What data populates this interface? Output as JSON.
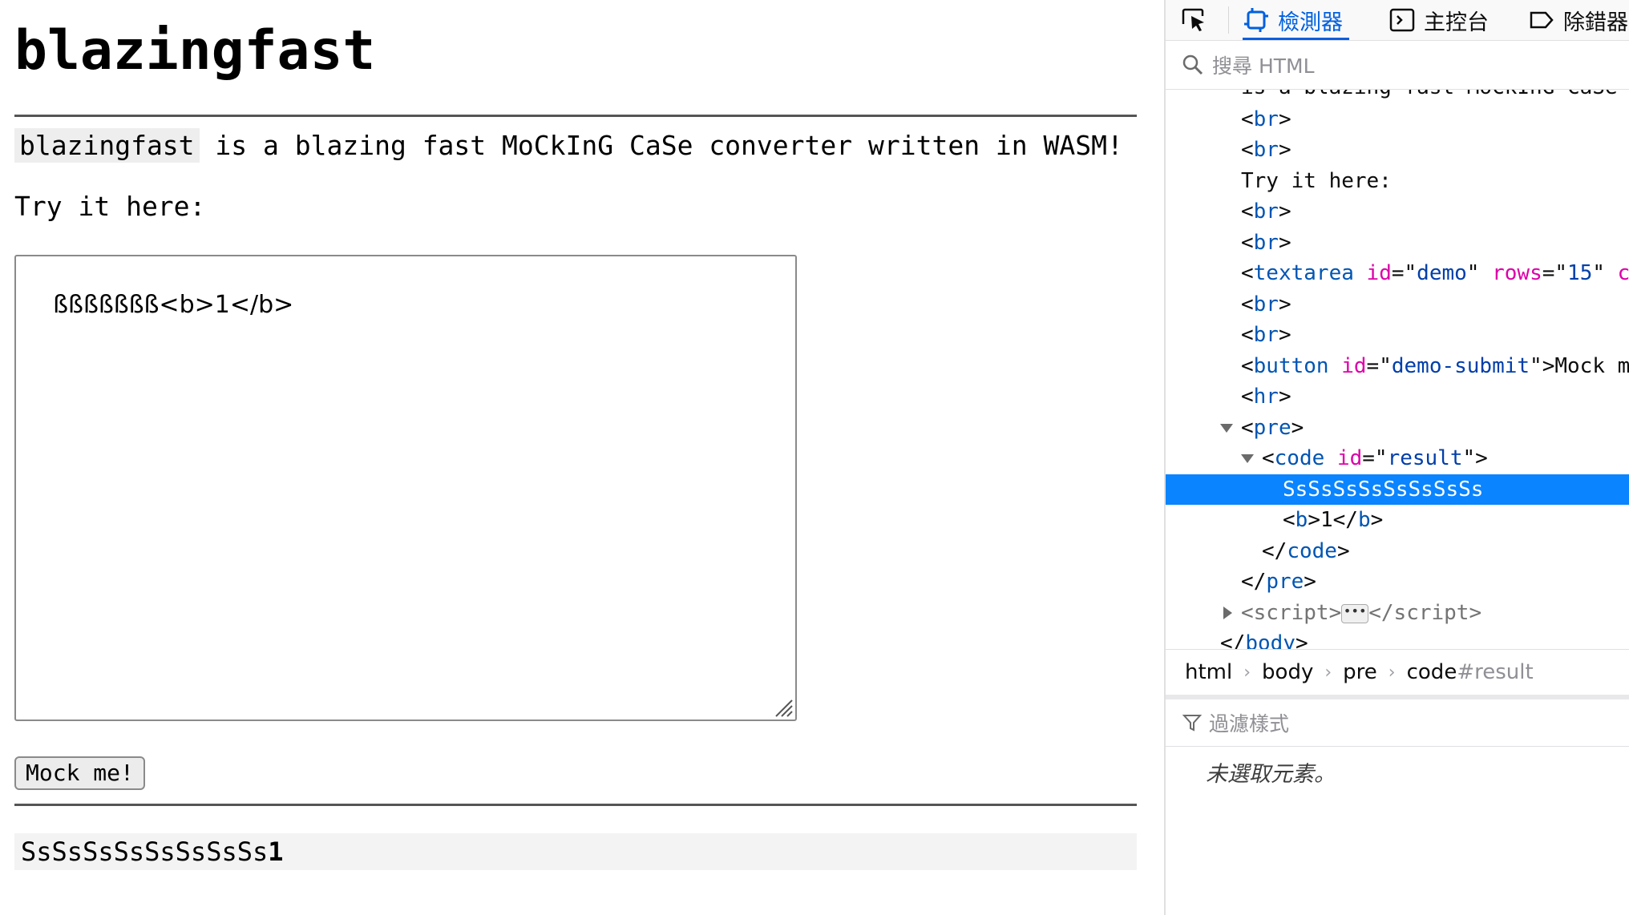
{
  "page": {
    "title": "blazingfast",
    "intro_code": "blazingfast",
    "intro_rest": " is a blazing fast MoCkInG CaSe converter written in WASM!",
    "try_label": "Try it here:",
    "textarea_value": "ßßßßßßß<b>1</b>",
    "button_label": "Mock me!",
    "result_text": "SsSsSsSsSsSsSsSs",
    "result_bold": "1"
  },
  "devtools": {
    "tabs": [
      {
        "label": "檢測器",
        "icon": "inspector-icon",
        "active": true
      },
      {
        "label": "主控台",
        "icon": "console-icon",
        "active": false
      },
      {
        "label": "除錯器",
        "icon": "debugger-icon",
        "active": false
      }
    ],
    "search_placeholder": "搜尋 HTML",
    "tree": {
      "cut_text": "is a blazing fast MoCkInG CaSe",
      "try_text": "Try it here:",
      "textarea_id": "demo",
      "textarea_rows": "15",
      "button_id": "demo-submit",
      "button_text": "Mock m",
      "code_id": "result",
      "selected_text": "SsSsSsSsSsSsSsSs",
      "b_text": "1"
    },
    "breadcrumbs": [
      "html",
      "body",
      "pre",
      "code"
    ],
    "breadcrumb_last_suffix": "#result",
    "filter_placeholder": "過濾樣式",
    "no_selection": "未選取元素。"
  }
}
